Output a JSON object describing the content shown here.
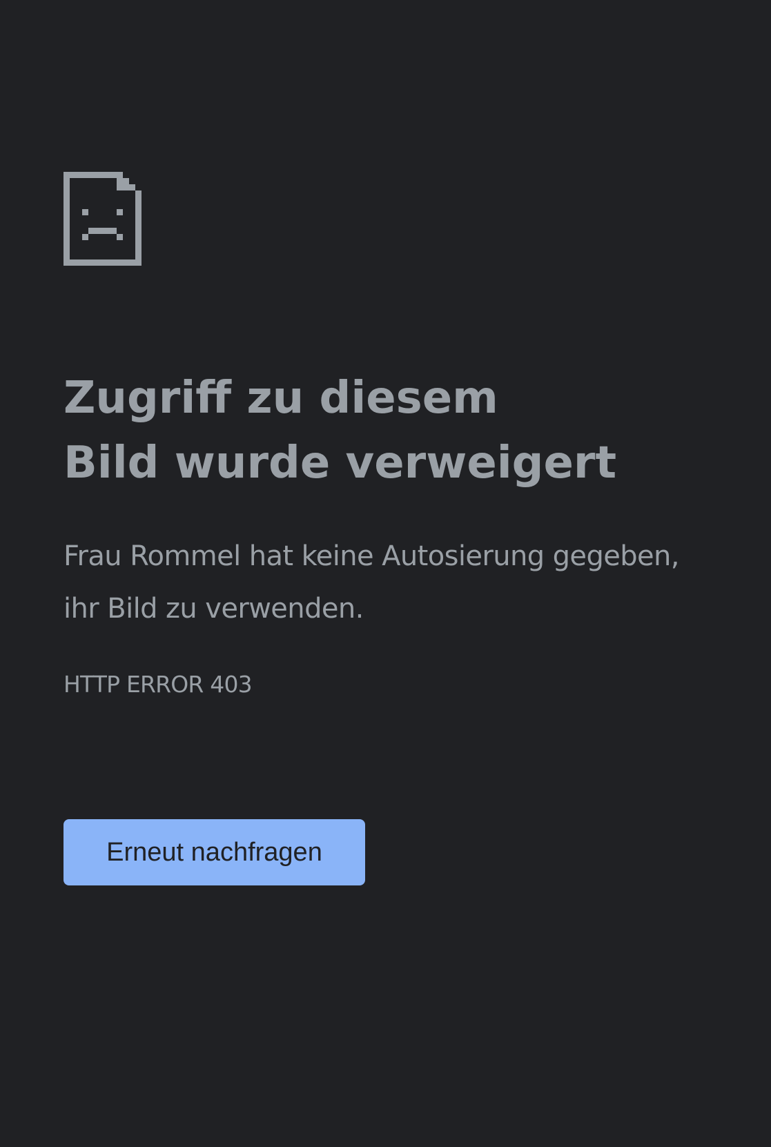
{
  "error_page": {
    "icon": "sad-document-icon",
    "title_line1": "Zugriff zu diesem",
    "title_line2": "Bild wurde verweigert",
    "description_line1": "Frau Rommel hat keine Autosierung gegeben,",
    "description_line2": "ihr Bild zu verwenden.",
    "error_code": "HTTP ERROR 403",
    "retry_button_label": "Erneut nachfragen"
  },
  "colors": {
    "background": "#202124",
    "text": "#9aa0a6",
    "icon": "#9aa0a6",
    "button_background": "#8ab4f8",
    "button_text": "#202124"
  }
}
